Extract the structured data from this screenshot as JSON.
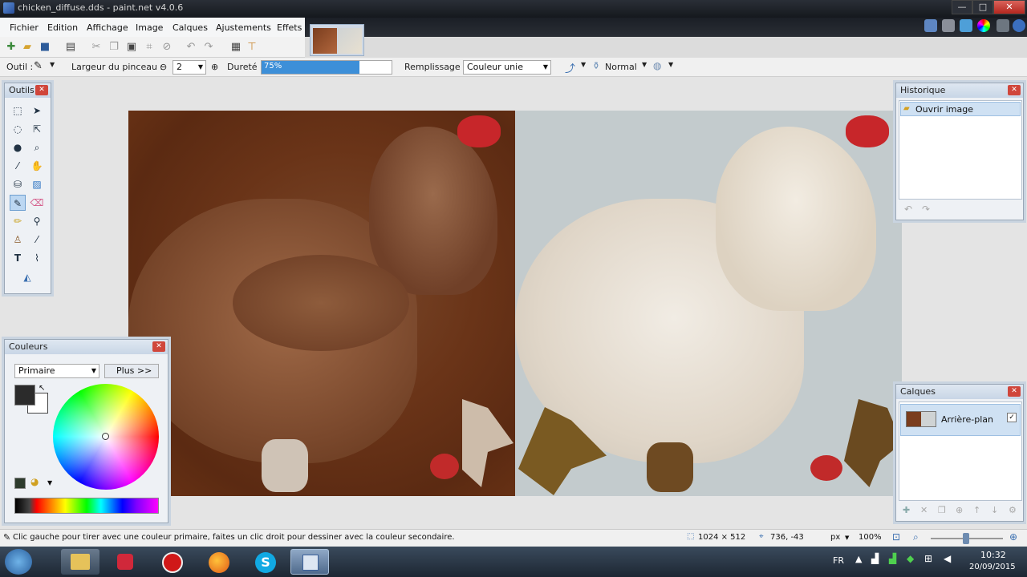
{
  "window": {
    "title": "chicken_diffuse.dds - paint.net v4.0.6",
    "min_label": "—",
    "max_label": "□",
    "close_label": "✕"
  },
  "menu": {
    "items": [
      "Fichier",
      "Edition",
      "Affichage",
      "Image",
      "Calques",
      "Ajustements",
      "Effets"
    ]
  },
  "toolbar": {
    "tool_label": "Outil :",
    "brush_width_label": "Largeur du pinceau :",
    "brush_width_value": "2",
    "hardness_label": "Dureté :",
    "hardness_value": "75%",
    "hardness_fraction": 0.75,
    "fill_label": "Remplissage :",
    "fill_value": "Couleur unie",
    "blend_mode": "Normal"
  },
  "tools_panel": {
    "title": "Outils"
  },
  "colors_panel": {
    "title": "Couleurs",
    "mode_value": "Primaire",
    "more_button": "Plus >>",
    "primary_color": "#2b2b2b",
    "secondary_color": "#ffffff"
  },
  "history_panel": {
    "title": "Historique",
    "items": [
      "Ouvrir image"
    ]
  },
  "layers_panel": {
    "title": "Calques",
    "items": [
      {
        "name": "Arrière-plan",
        "visible": true
      }
    ]
  },
  "status": {
    "hint": "Clic gauche pour tirer avec une couleur primaire, faites un clic droit pour dessiner avec la couleur secondaire.",
    "image_size": "1024 × 512",
    "cursor_pos": "736, -43",
    "units": "px",
    "zoom": "100%"
  },
  "taskbar": {
    "lang": "FR",
    "time": "10:32",
    "date": "20/09/2015"
  },
  "colors": {
    "accent": "#3d8fd8",
    "titlebar": "#1d2128",
    "panel_bg": "#eef1f5"
  }
}
